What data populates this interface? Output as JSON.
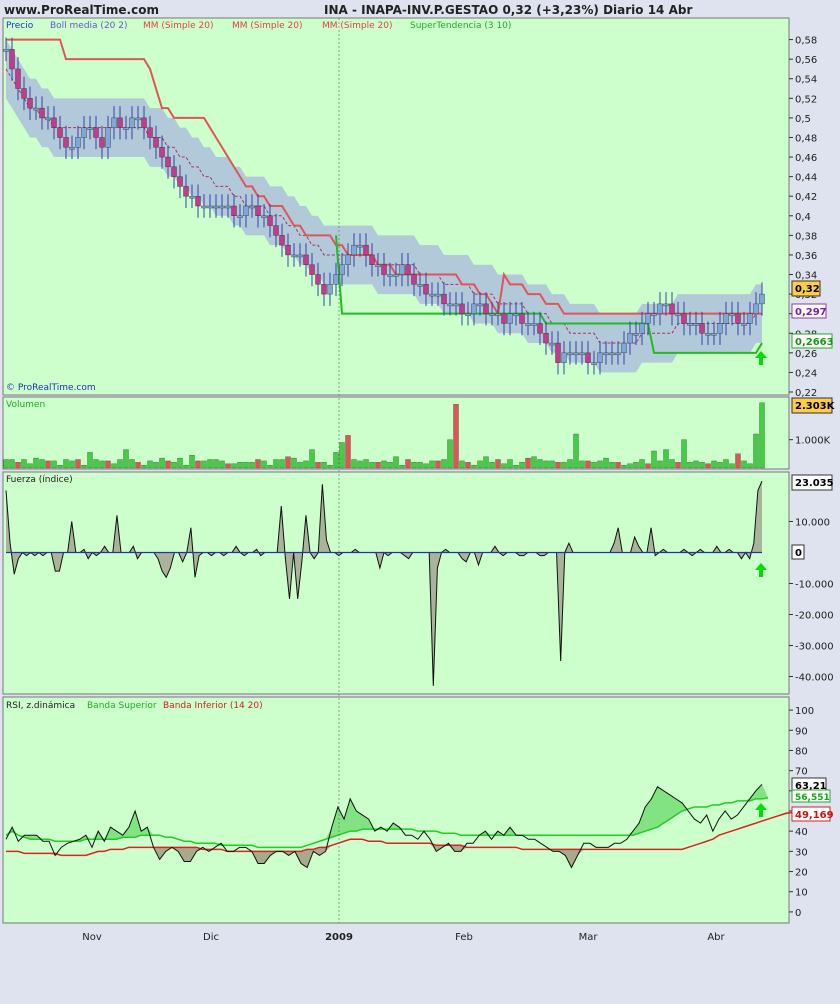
{
  "header": {
    "site": "www.ProRealTime.com",
    "title": "INA - INAPA-INV.P.GESTAO    0,32 (+3,23%)    Diario  14 Abr",
    "watermark": "© ProRealTime.com"
  },
  "colors": {
    "panel_bg": "#ccffcc",
    "page_bg": "#dfe3ef",
    "bull": "#7ea8d8",
    "bear": "#c03c8c",
    "red_line": "#e05555",
    "support": "#22bb22",
    "boll": "#a9b7de",
    "vol_green": "#44cc44",
    "vol_red": "#dd5555",
    "rsi_upper": "#22cc22",
    "rsi_lower": "#dd2222"
  },
  "x_labels": [
    "Nov",
    "Dic",
    "2009",
    "Feb",
    "Mar",
    "Abr"
  ],
  "chart_data": [
    {
      "type": "line",
      "title": "INA - INAPA-INV.P.GESTAO",
      "legend": [
        "Precio",
        "Boll media (20 2)",
        "MM (Simple 20)",
        "MM (Simple 20)",
        "MM (Simple 20)",
        "SuperTendencia (3 10)"
      ],
      "ylim": [
        0.22,
        0.6
      ],
      "y_ticks": [
        "0,58",
        "0,56",
        "0,54",
        "0,52",
        "0,5",
        "0,48",
        "0,46",
        "0,44",
        "0,42",
        "0,4",
        "0,38",
        "0,36",
        "0,34",
        "0,32",
        "0,3",
        "0,28",
        "0,26",
        "0,24",
        "0,22"
      ],
      "value_labels": {
        "price": "0,32",
        "ma": "0,297",
        "supertrend": "0,2663"
      },
      "close": [
        0.57,
        0.55,
        0.53,
        0.52,
        0.51,
        0.51,
        0.5,
        0.5,
        0.49,
        0.48,
        0.47,
        0.47,
        0.48,
        0.49,
        0.49,
        0.48,
        0.47,
        0.49,
        0.5,
        0.49,
        0.49,
        0.5,
        0.5,
        0.49,
        0.48,
        0.47,
        0.46,
        0.45,
        0.44,
        0.43,
        0.42,
        0.42,
        0.41,
        0.41,
        0.41,
        0.41,
        0.41,
        0.41,
        0.4,
        0.4,
        0.41,
        0.41,
        0.4,
        0.4,
        0.39,
        0.38,
        0.37,
        0.36,
        0.36,
        0.36,
        0.35,
        0.34,
        0.33,
        0.32,
        0.33,
        0.34,
        0.35,
        0.36,
        0.37,
        0.37,
        0.36,
        0.35,
        0.35,
        0.34,
        0.34,
        0.34,
        0.35,
        0.34,
        0.33,
        0.33,
        0.32,
        0.32,
        0.32,
        0.31,
        0.31,
        0.31,
        0.3,
        0.3,
        0.31,
        0.31,
        0.3,
        0.3,
        0.3,
        0.29,
        0.3,
        0.3,
        0.29,
        0.29,
        0.29,
        0.28,
        0.27,
        0.27,
        0.25,
        0.26,
        0.26,
        0.26,
        0.26,
        0.25,
        0.25,
        0.26,
        0.26,
        0.26,
        0.26,
        0.27,
        0.28,
        0.28,
        0.29,
        0.3,
        0.3,
        0.31,
        0.31,
        0.3,
        0.3,
        0.29,
        0.29,
        0.29,
        0.28,
        0.28,
        0.28,
        0.29,
        0.3,
        0.3,
        0.29,
        0.29,
        0.3,
        0.31,
        0.32
      ],
      "bollinger_mid": [
        0.55,
        0.54,
        0.53,
        0.52,
        0.51,
        0.51,
        0.5,
        0.5,
        0.49,
        0.49,
        0.49,
        0.49,
        0.49,
        0.49,
        0.49,
        0.49,
        0.49,
        0.49,
        0.49,
        0.49,
        0.49,
        0.49,
        0.49,
        0.49,
        0.48,
        0.48,
        0.48,
        0.47,
        0.47,
        0.46,
        0.46,
        0.45,
        0.45,
        0.44,
        0.44,
        0.43,
        0.43,
        0.43,
        0.42,
        0.42,
        0.41,
        0.41,
        0.41,
        0.41,
        0.4,
        0.4,
        0.4,
        0.39,
        0.39,
        0.38,
        0.38,
        0.37,
        0.37,
        0.36,
        0.36,
        0.36,
        0.36,
        0.36,
        0.36,
        0.36,
        0.36,
        0.36,
        0.35,
        0.35,
        0.35,
        0.35,
        0.35,
        0.35,
        0.35,
        0.34,
        0.34,
        0.34,
        0.34,
        0.33,
        0.33,
        0.33,
        0.33,
        0.33,
        0.32,
        0.32,
        0.32,
        0.32,
        0.31,
        0.31,
        0.31,
        0.31,
        0.31,
        0.3,
        0.3,
        0.3,
        0.3,
        0.29,
        0.29,
        0.29,
        0.28,
        0.28,
        0.28,
        0.28,
        0.28,
        0.27,
        0.27,
        0.27,
        0.27,
        0.27,
        0.27,
        0.27,
        0.28,
        0.28,
        0.28,
        0.28,
        0.28,
        0.28,
        0.29,
        0.29,
        0.29,
        0.29,
        0.29,
        0.29,
        0.29,
        0.29,
        0.29,
        0.29,
        0.29,
        0.29,
        0.29,
        0.3,
        0.3
      ],
      "band_width": 0.03,
      "red_ma": [
        0.58,
        0.58,
        0.58,
        0.58,
        0.58,
        0.58,
        0.58,
        0.58,
        0.58,
        0.58,
        0.56,
        0.56,
        0.56,
        0.56,
        0.56,
        0.56,
        0.56,
        0.56,
        0.56,
        0.56,
        0.56,
        0.56,
        0.56,
        0.56,
        0.55,
        0.53,
        0.51,
        0.51,
        0.5,
        0.5,
        0.5,
        0.5,
        0.5,
        0.5,
        0.49,
        0.48,
        0.47,
        0.46,
        0.45,
        0.44,
        0.43,
        0.43,
        0.42,
        0.42,
        0.41,
        0.41,
        0.41,
        0.4,
        0.39,
        0.39,
        0.38,
        0.38,
        0.38,
        0.38,
        0.38,
        0.37,
        0.37,
        0.36,
        0.36,
        0.36,
        0.36,
        0.36,
        0.35,
        0.35,
        0.35,
        0.34,
        0.34,
        0.34,
        0.34,
        0.34,
        0.34,
        0.34,
        0.34,
        0.34,
        0.34,
        0.34,
        0.33,
        0.33,
        0.33,
        0.32,
        0.32,
        0.31,
        0.3,
        0.34,
        0.33,
        0.33,
        0.33,
        0.32,
        0.32,
        0.32,
        0.31,
        0.31,
        0.31,
        0.3,
        0.3,
        0.3,
        0.3,
        0.3,
        0.3,
        0.3,
        0.3,
        0.3,
        0.3,
        0.3,
        0.3,
        0.3,
        0.3,
        0.3,
        0.3,
        0.3,
        0.3,
        0.3,
        0.3,
        0.3,
        0.3,
        0.3,
        0.3,
        0.3,
        0.3,
        0.3,
        0.3,
        0.3,
        0.3,
        0.3,
        0.3,
        0.3,
        0.3
      ],
      "supertrend": [
        null,
        null,
        null,
        null,
        null,
        null,
        null,
        null,
        null,
        null,
        null,
        null,
        null,
        null,
        null,
        null,
        null,
        null,
        null,
        null,
        null,
        null,
        null,
        null,
        null,
        null,
        null,
        null,
        null,
        null,
        null,
        null,
        null,
        null,
        null,
        null,
        null,
        null,
        null,
        null,
        null,
        null,
        null,
        null,
        null,
        null,
        null,
        null,
        null,
        null,
        null,
        null,
        null,
        null,
        null,
        0.38,
        0.3,
        0.3,
        0.3,
        0.3,
        0.3,
        0.3,
        0.3,
        0.3,
        0.3,
        0.3,
        0.3,
        0.3,
        0.3,
        0.3,
        0.3,
        0.3,
        0.3,
        0.3,
        0.3,
        0.3,
        0.3,
        0.3,
        0.3,
        0.3,
        0.3,
        0.3,
        0.3,
        0.3,
        0.3,
        0.3,
        0.3,
        0.3,
        0.3,
        0.3,
        0.29,
        0.29,
        0.29,
        0.29,
        0.29,
        0.29,
        0.29,
        0.29,
        0.29,
        0.29,
        0.29,
        0.29,
        0.29,
        0.29,
        0.29,
        0.29,
        0.29,
        0.29,
        0.26,
        0.26,
        0.26,
        0.26,
        0.26,
        0.26,
        0.26,
        0.26,
        0.26,
        0.26,
        0.26,
        0.26,
        0.26,
        0.26,
        0.26,
        0.26,
        0.26,
        0.26,
        0.27
      ]
    },
    {
      "type": "bar",
      "title": "Volumen",
      "value_label": "2.303K",
      "y_ticks": [
        "1.000K"
      ],
      "ylim": [
        0,
        2400
      ],
      "values": [
        300,
        300,
        200,
        300,
        150,
        350,
        300,
        250,
        250,
        100,
        300,
        250,
        300,
        100,
        550,
        300,
        250,
        250,
        150,
        300,
        650,
        300,
        200,
        100,
        250,
        200,
        350,
        250,
        200,
        350,
        100,
        450,
        250,
        250,
        300,
        300,
        250,
        150,
        150,
        200,
        200,
        200,
        300,
        250,
        100,
        300,
        300,
        400,
        350,
        200,
        250,
        650,
        200,
        200,
        100,
        550,
        900,
        1150,
        300,
        250,
        300,
        200,
        200,
        250,
        200,
        400,
        100,
        300,
        200,
        200,
        150,
        250,
        250,
        300,
        1000,
        2250,
        250,
        200,
        100,
        250,
        400,
        200,
        300,
        150,
        300,
        100,
        200,
        350,
        400,
        300,
        250,
        250,
        200,
        200,
        300,
        1200,
        250,
        250,
        200,
        250,
        350,
        200,
        200,
        100,
        150,
        200,
        300,
        150,
        600,
        250,
        650,
        300,
        200,
        1000,
        200,
        250,
        200,
        150,
        250,
        200,
        300,
        150,
        500,
        250,
        150,
        1200,
        2303
      ]
    },
    {
      "type": "area",
      "title": "Fuerza (índice)",
      "value_label": "0",
      "y_ticks": [
        "10.000",
        "0",
        "-10.000",
        "-20.000",
        "-30.000",
        "-40.000"
      ],
      "ylim": [
        -45000,
        25000
      ],
      "values": [
        20000,
        3000,
        -7000,
        -2000,
        0,
        -1000,
        0,
        -1000,
        0,
        -1000,
        0,
        0,
        -6000,
        -6000,
        0,
        0,
        10000,
        0,
        0,
        1000,
        -2000,
        0,
        -1000,
        0,
        2000,
        0,
        0,
        12000,
        0,
        0,
        0,
        2000,
        -2000,
        0,
        0,
        0,
        0,
        -2000,
        -6000,
        -8000,
        -5000,
        0,
        0,
        -3000,
        0,
        8000,
        -8000,
        -1000,
        0,
        0,
        -1000,
        0,
        0,
        -1000,
        0,
        0,
        2000,
        0,
        -1000,
        0,
        0,
        1000,
        -1000,
        0,
        0,
        0,
        0,
        15000,
        -2000,
        -15000,
        0,
        -15000,
        -3000,
        12000,
        0,
        -2000,
        0,
        22000,
        4000,
        0,
        0,
        -1000,
        0,
        0,
        0,
        1000,
        0,
        0,
        0,
        0,
        0,
        -5000,
        0,
        -1000,
        0,
        0,
        0,
        -1000,
        -2000,
        0,
        0,
        0,
        0,
        0,
        -43000,
        -5000,
        0,
        1000,
        0,
        0,
        0,
        -2000,
        -3000,
        0,
        0,
        -4000,
        0,
        0,
        0,
        2000,
        0,
        -1000,
        0,
        0,
        0,
        -1000,
        -1000,
        0,
        0,
        0,
        -1000,
        -1000,
        0,
        0,
        0,
        -35000,
        0,
        3000,
        0,
        0,
        0,
        0,
        0,
        0,
        0,
        0,
        0,
        0,
        3000,
        8000,
        0,
        0,
        0,
        5000,
        2000,
        0,
        0,
        8000,
        -1000,
        0,
        1000,
        0,
        0,
        0,
        0,
        1000,
        0,
        -1000,
        0,
        1000,
        0,
        0,
        0,
        2000,
        0,
        0,
        1000,
        0,
        0,
        -2000,
        0,
        -2000,
        3000,
        20000,
        23035
      ]
    },
    {
      "type": "line",
      "title": "RSI, z.dinámica",
      "legend": [
        "Banda Superior",
        "Banda Inferior (14 20)"
      ],
      "value_labels": {
        "rsi": "63,21",
        "upper": "56,551",
        "lower": "49,169"
      },
      "y_ticks": [
        "100",
        "90",
        "80",
        "70",
        "60",
        "50",
        "40",
        "30",
        "20",
        "10",
        "0"
      ],
      "ylim": [
        -5,
        105
      ],
      "rsi": [
        36,
        42,
        35,
        38,
        38,
        38,
        35,
        35,
        28,
        32,
        34,
        35,
        36,
        38,
        32,
        40,
        35,
        42,
        40,
        38,
        42,
        50,
        40,
        42,
        32,
        26,
        30,
        32,
        30,
        25,
        25,
        30,
        32,
        30,
        32,
        34,
        30,
        30,
        32,
        32,
        30,
        24,
        24,
        28,
        30,
        30,
        28,
        30,
        24,
        22,
        30,
        28,
        30,
        42,
        52,
        46,
        56,
        50,
        48,
        46,
        40,
        42,
        40,
        44,
        42,
        38,
        38,
        36,
        40,
        36,
        30,
        32,
        34,
        30,
        30,
        34,
        34,
        38,
        40,
        36,
        40,
        38,
        42,
        38,
        38,
        36,
        36,
        34,
        32,
        30,
        30,
        28,
        22,
        28,
        34,
        34,
        32,
        32,
        32,
        34,
        34,
        36,
        40,
        44,
        52,
        56,
        62,
        60,
        58,
        56,
        54,
        50,
        46,
        44,
        48,
        40,
        46,
        50,
        46,
        48,
        52,
        56,
        60,
        63.21
      ],
      "upper": [
        38,
        40,
        38,
        37,
        36,
        36,
        36,
        36,
        35,
        35,
        35,
        35,
        35,
        36,
        36,
        36,
        36,
        36,
        36,
        37,
        37,
        37,
        38,
        38,
        38,
        38,
        37,
        37,
        36,
        35,
        35,
        34,
        34,
        34,
        34,
        33,
        33,
        33,
        33,
        33,
        33,
        32,
        32,
        32,
        32,
        32,
        32,
        32,
        32,
        33,
        34,
        35,
        36,
        37,
        38,
        39,
        40,
        40,
        41,
        41,
        41,
        41,
        41,
        41,
        41,
        41,
        41,
        40,
        40,
        40,
        40,
        39,
        39,
        39,
        38,
        38,
        38,
        38,
        38,
        38,
        38,
        38,
        38,
        38,
        38,
        38,
        38,
        38,
        38,
        38,
        38,
        38,
        38,
        38,
        38,
        38,
        38,
        38,
        38,
        38,
        38,
        38,
        38,
        39,
        40,
        41,
        42,
        44,
        46,
        48,
        50,
        51,
        52,
        52,
        52,
        53,
        53,
        54,
        54,
        55,
        55,
        55,
        56,
        56,
        56.551
      ],
      "lower": [
        30,
        30,
        30,
        29,
        29,
        29,
        29,
        29,
        29,
        28,
        28,
        28,
        28,
        28,
        29,
        30,
        30,
        31,
        31,
        31,
        32,
        32,
        32,
        32,
        32,
        32,
        32,
        32,
        32,
        32,
        32,
        32,
        31,
        31,
        31,
        31,
        30,
        30,
        30,
        30,
        30,
        30,
        30,
        30,
        30,
        30,
        30,
        30,
        30,
        31,
        31,
        32,
        32,
        33,
        34,
        35,
        36,
        36,
        36,
        35,
        35,
        35,
        34,
        34,
        34,
        34,
        34,
        34,
        34,
        34,
        33,
        33,
        33,
        33,
        33,
        32,
        32,
        32,
        32,
        32,
        32,
        32,
        32,
        32,
        31,
        31,
        31,
        31,
        31,
        31,
        31,
        31,
        31,
        31,
        31,
        31,
        31,
        31,
        31,
        31,
        31,
        31,
        31,
        31,
        31,
        31,
        31,
        31,
        31,
        31,
        31,
        32,
        33,
        34,
        35,
        36,
        38,
        39,
        40,
        41,
        42,
        43,
        44,
        45,
        46,
        47,
        48,
        49,
        49.169
      ]
    }
  ]
}
